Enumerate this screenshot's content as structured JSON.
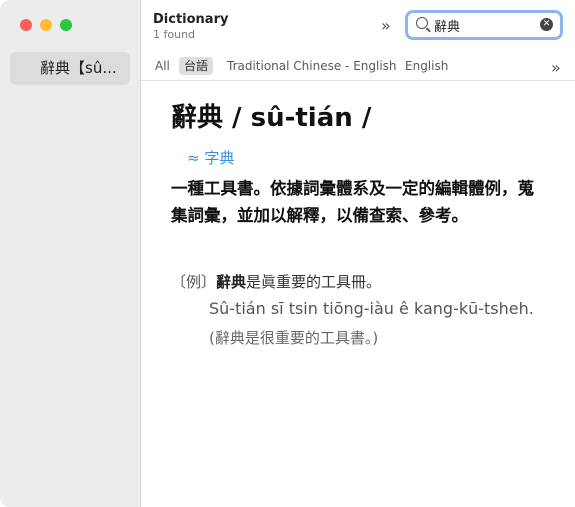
{
  "sidebar": {
    "items": [
      {
        "label": "辭典【sû..."
      }
    ]
  },
  "header": {
    "title": "Dictionary",
    "result_count": "1 found",
    "more_chevron": "»"
  },
  "search": {
    "value": "辭典",
    "icon": "search-icon",
    "clear_icon": "clear-icon"
  },
  "tabs": [
    {
      "label": "All",
      "active": false
    },
    {
      "label": "台語",
      "active": true
    },
    {
      "label": "Traditional Chinese - English",
      "active": false
    },
    {
      "label": "English",
      "active": false
    }
  ],
  "tabs_more": "»",
  "entry": {
    "headword": "辭典 / sû-tián /",
    "xref_symbol": "≈",
    "xref": "字典",
    "definition": "一種工具書。依據詞彙體系及一定的編輯體例，蒐集詞彙，並加以解釋，以備查索、參考。",
    "example_marker": "〔例〕",
    "example_term": "辭典",
    "example_rest": "是眞重要的工具冊。",
    "example_romanization": "Sû-tián sī tsin tiōng-iàu ê kang-kū-tsheh.",
    "example_gloss": "(辭典是很重要的工具書。)"
  },
  "colors": {
    "sidebar_bg": "#ececec",
    "link": "#3a8ee0",
    "search_focus": "#8db4ee",
    "traffic_red": "#fe5f57",
    "traffic_yellow": "#febc2e",
    "traffic_green": "#28c840"
  }
}
